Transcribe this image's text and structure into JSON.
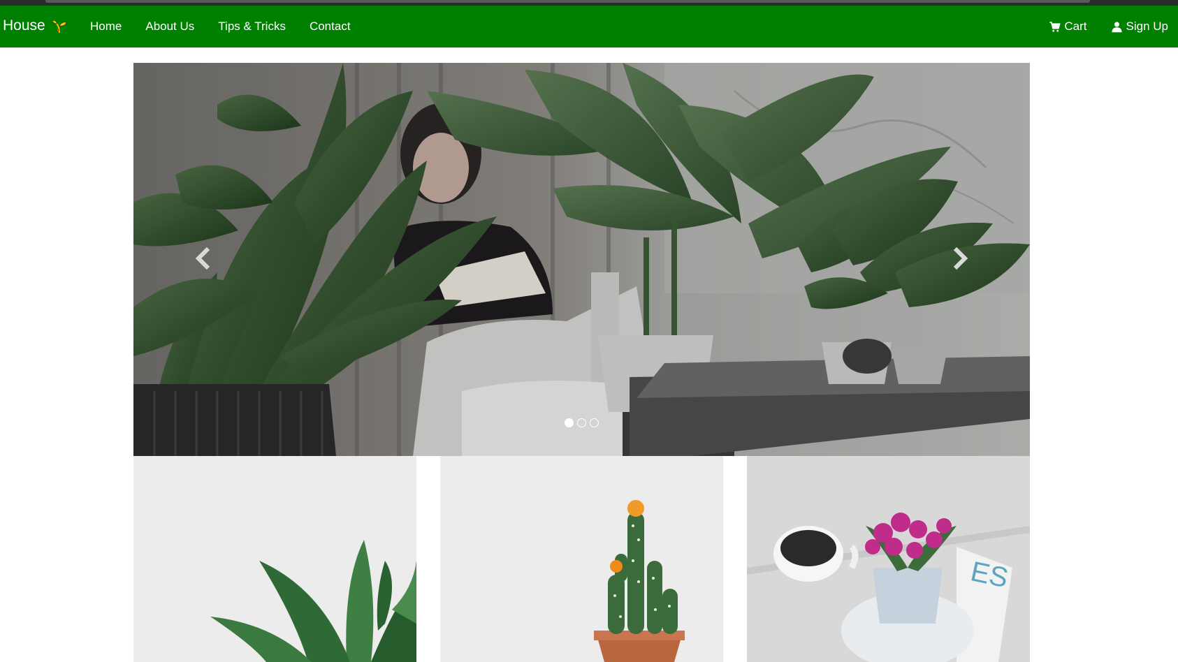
{
  "navbar": {
    "brand": "House",
    "brand_icon": "sprout-icon",
    "links": [
      "Home",
      "About Us",
      "Tips & Tricks",
      "Contact"
    ],
    "cart_label": "Cart",
    "signup_label": "Sign Up",
    "background_color": "#008000",
    "text_color": "#ffffff"
  },
  "carousel": {
    "slide_count": 3,
    "active_index": 0,
    "image_alt": "woman reading among indoor plants",
    "prev_icon": "chevron-left-icon",
    "next_icon": "chevron-right-icon"
  },
  "gallery": [
    {
      "image": "succulent plant"
    },
    {
      "image": "cactus in terracotta pot"
    },
    {
      "image": "pink flowering plant with coffee cup"
    }
  ]
}
